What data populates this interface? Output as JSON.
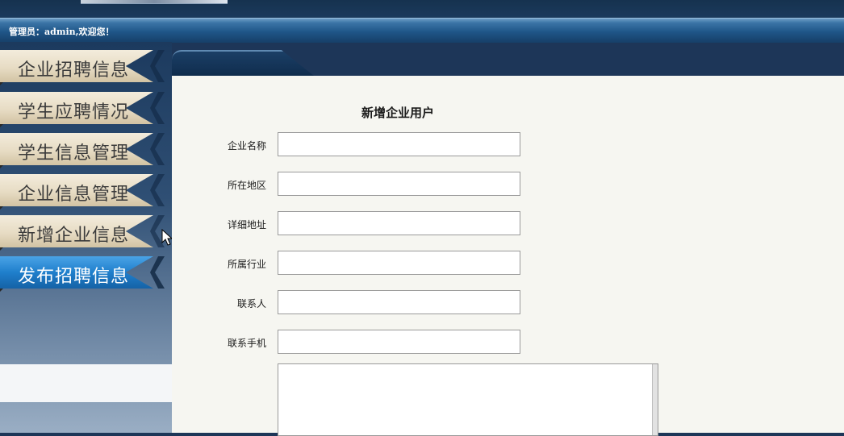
{
  "header": {
    "greeting": "管理员：admin,欢迎您！"
  },
  "sidebar": {
    "items": [
      {
        "label": "企业招聘信息",
        "active": false
      },
      {
        "label": "学生应聘情况",
        "active": false
      },
      {
        "label": "学生信息管理",
        "active": false
      },
      {
        "label": "企业信息管理",
        "active": false
      },
      {
        "label": "新增企业信息",
        "active": false
      },
      {
        "label": "发布招聘信息",
        "active": true
      }
    ]
  },
  "form": {
    "title": "新增企业用户",
    "fields": [
      {
        "label": "企业名称",
        "value": ""
      },
      {
        "label": "所在地区",
        "value": ""
      },
      {
        "label": "详细地址",
        "value": ""
      },
      {
        "label": "所属行业",
        "value": ""
      },
      {
        "label": "联系人",
        "value": ""
      },
      {
        "label": "联系手机",
        "value": ""
      }
    ]
  },
  "colors": {
    "active_tab": "#1f7fcc",
    "header_bar": "#1f5688",
    "panel_bg": "#f6f6f1"
  }
}
